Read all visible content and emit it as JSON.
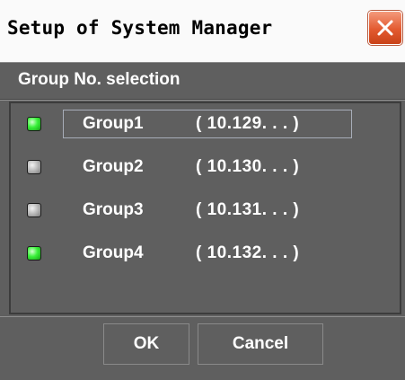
{
  "window": {
    "title": "Setup of System Manager",
    "close_icon": "close-icon"
  },
  "dialog": {
    "heading": "Group No. selection",
    "groups": [
      {
        "name": "Group1",
        "address": "( 10.129. . . )",
        "status": "active",
        "focused": true
      },
      {
        "name": "Group2",
        "address": "( 10.130. . . )",
        "status": "inactive",
        "focused": false
      },
      {
        "name": "Group3",
        "address": "( 10.131. . . )",
        "status": "inactive",
        "focused": false
      },
      {
        "name": "Group4",
        "address": "( 10.132. . . )",
        "status": "active",
        "focused": false
      }
    ]
  },
  "buttons": {
    "ok_label": "OK",
    "cancel_label": "Cancel"
  },
  "colors": {
    "background": "#5f5f5f",
    "active_led": "#3bf23b",
    "inactive_led": "#bdbdbd",
    "close_button": "#e35a30"
  }
}
